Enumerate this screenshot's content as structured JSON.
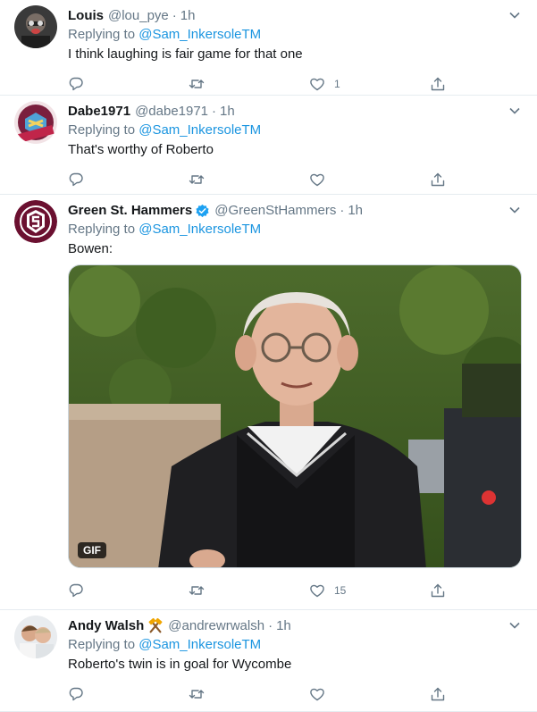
{
  "tweets": [
    {
      "name": "Louis",
      "handle": "@lou_pye",
      "time": "1h",
      "replying_prefix": "Replying to ",
      "replying_to": "@Sam_InkersoleTM",
      "text": "I think laughing is fair game for that one",
      "likes": "1"
    },
    {
      "name": "Dabe1971",
      "handle": "@dabe1971",
      "time": "1h",
      "replying_prefix": "Replying to ",
      "replying_to": "@Sam_InkersoleTM",
      "text": "That's worthy of Roberto",
      "likes": ""
    },
    {
      "name": "Green St. Hammers",
      "handle": "@GreenStHammers",
      "time": "1h",
      "replying_prefix": "Replying to ",
      "replying_to": "@Sam_InkersoleTM",
      "text": "Bowen:",
      "media_badge": "GIF",
      "likes": "15"
    },
    {
      "name": "Andy Walsh",
      "handle": "@andrewrwalsh",
      "time": "1h",
      "replying_prefix": "Replying to ",
      "replying_to": "@Sam_InkersoleTM",
      "text": "Roberto's twin is in goal for Wycombe",
      "likes": ""
    }
  ],
  "separator": "·",
  "colors": {
    "link": "#1b95e0",
    "muted": "#657786",
    "verified": "#1da1f2",
    "border": "#e6ecf0"
  },
  "icons": [
    "reply-icon",
    "retweet-icon",
    "like-icon",
    "share-icon",
    "chevron-down-icon",
    "verified-badge-icon",
    "hammers-emoji-icon"
  ]
}
